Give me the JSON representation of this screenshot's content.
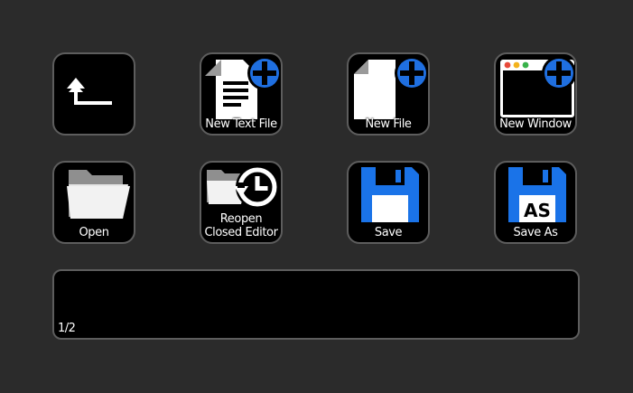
{
  "keys": {
    "back": {
      "label": "",
      "icon": "back-arrow-icon"
    },
    "new_text_file": {
      "label": "New Text File",
      "icon": "new-text-file-icon"
    },
    "new_file": {
      "label": "New File",
      "icon": "new-file-icon"
    },
    "new_window": {
      "label": "New Window",
      "icon": "new-window-icon"
    },
    "open": {
      "label": "Open",
      "icon": "folder-open-icon"
    },
    "reopen": {
      "label": "Reopen\nClosed Editor",
      "icon": "reopen-history-icon"
    },
    "save": {
      "label": "Save",
      "icon": "floppy-disk-icon"
    },
    "save_as": {
      "label": "Save As",
      "icon": "floppy-disk-as-icon",
      "badge": "AS"
    }
  },
  "page_indicator": "1/2",
  "colors": {
    "background": "#2b2b2b",
    "key_bg": "#000000",
    "key_border": "#5d5d5d",
    "accent_blue": "#1a73e8",
    "plus_blue": "#1f6fe0"
  }
}
